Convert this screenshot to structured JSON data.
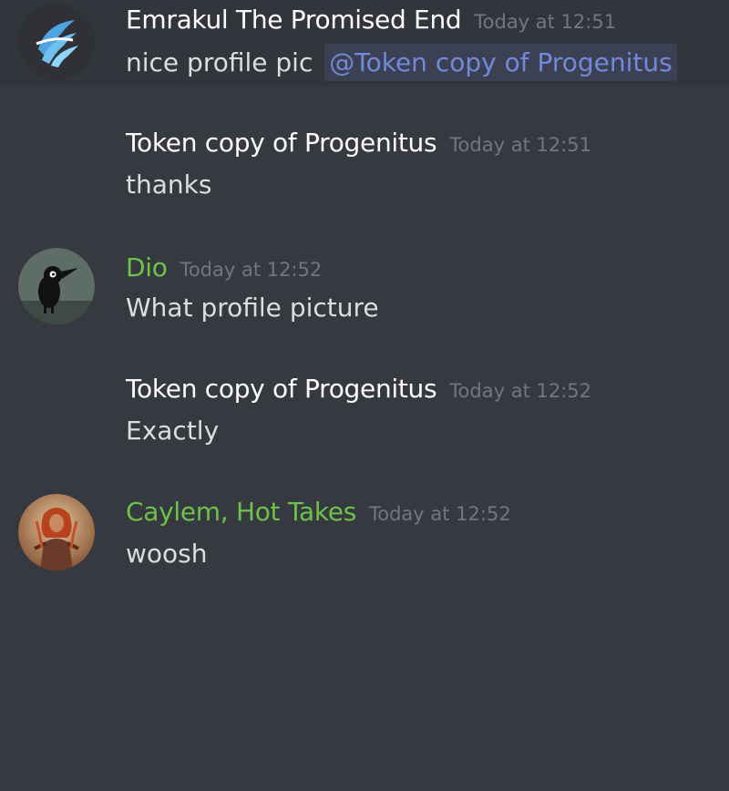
{
  "colors": {
    "background": "#36393f",
    "highlight_row": "#32353b",
    "username_default": "#ffffff",
    "username_green": "#6cc24a",
    "timestamp": "#72767d",
    "message_text": "#dcddde",
    "mention": "#7289da"
  },
  "messages": [
    {
      "author": "Emrakul The Promised End",
      "timestamp": "Today at 12:51",
      "text": "nice profile pic",
      "mention": "@Token copy of Progenitus",
      "avatar_icon": "emrakul-avatar-icon"
    },
    {
      "author": "Token copy of Progenitus",
      "timestamp": "Today at 12:51",
      "text": "thanks"
    },
    {
      "author": "Dio",
      "timestamp": "Today at 12:52",
      "text": "What profile picture",
      "avatar_icon": "crow-avatar-icon"
    },
    {
      "author": "Token copy of Progenitus",
      "timestamp": "Today at 12:52",
      "text": "Exactly"
    },
    {
      "author": "Caylem, Hot Takes",
      "timestamp": "Today at 12:52",
      "text": "woosh",
      "avatar_icon": "warrior-avatar-icon"
    }
  ]
}
